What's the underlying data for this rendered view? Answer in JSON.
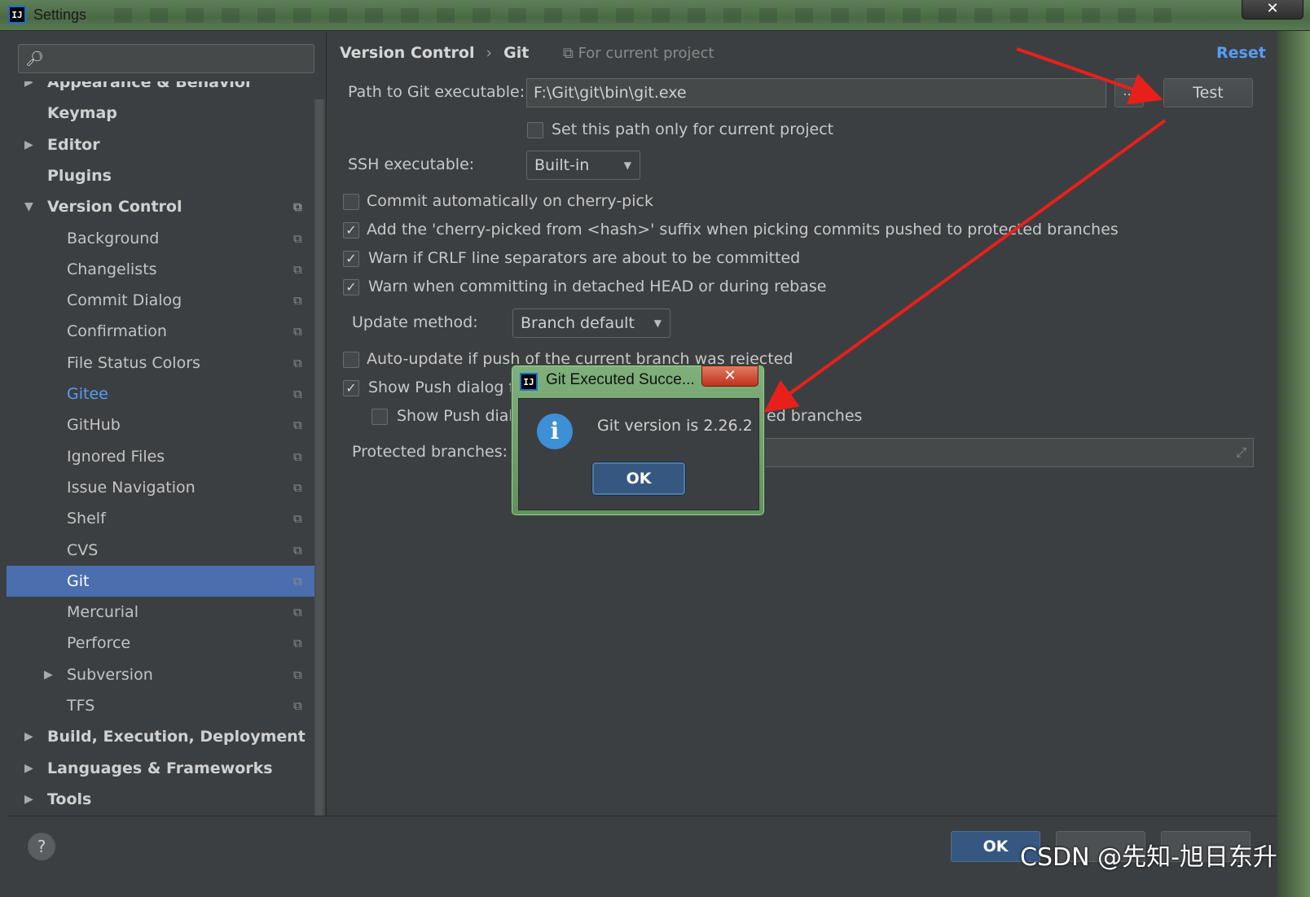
{
  "window": {
    "title": "Settings",
    "close_glyph": "✕"
  },
  "search": {
    "icon": "search-icon",
    "placeholder": ""
  },
  "tree": {
    "items": [
      {
        "label": "Appearance & Behavior",
        "level": 0,
        "bold": true,
        "expander": "right"
      },
      {
        "label": "Keymap",
        "level": 0,
        "bold": true
      },
      {
        "label": "Editor",
        "level": 0,
        "bold": true,
        "expander": "right"
      },
      {
        "label": "Plugins",
        "level": 0,
        "bold": true
      },
      {
        "label": "Version Control",
        "level": 0,
        "bold": true,
        "expander": "down",
        "project": true
      },
      {
        "label": "Background",
        "level": 1,
        "project": true
      },
      {
        "label": "Changelists",
        "level": 1,
        "project": true
      },
      {
        "label": "Commit Dialog",
        "level": 1,
        "project": true
      },
      {
        "label": "Confirmation",
        "level": 1,
        "project": true
      },
      {
        "label": "File Status Colors",
        "level": 1,
        "project": true
      },
      {
        "label": "Gitee",
        "level": 1,
        "project": true,
        "link": true
      },
      {
        "label": "GitHub",
        "level": 1,
        "project": true
      },
      {
        "label": "Ignored Files",
        "level": 1,
        "project": true
      },
      {
        "label": "Issue Navigation",
        "level": 1,
        "project": true
      },
      {
        "label": "Shelf",
        "level": 1,
        "project": true
      },
      {
        "label": "CVS",
        "level": 1,
        "project": true
      },
      {
        "label": "Git",
        "level": 1,
        "project": true,
        "selected": true
      },
      {
        "label": "Mercurial",
        "level": 1,
        "project": true
      },
      {
        "label": "Perforce",
        "level": 1,
        "project": true
      },
      {
        "label": "Subversion",
        "level": 1,
        "project": true,
        "expander": "right"
      },
      {
        "label": "TFS",
        "level": 1,
        "project": true
      },
      {
        "label": "Build, Execution, Deployment",
        "level": 0,
        "bold": true,
        "expander": "right"
      },
      {
        "label": "Languages & Frameworks",
        "level": 0,
        "bold": true,
        "expander": "right"
      },
      {
        "label": "Tools",
        "level": 0,
        "bold": true,
        "expander": "right"
      }
    ]
  },
  "header": {
    "breadcrumb_parent": "Version Control",
    "breadcrumb_sep": "›",
    "breadcrumb_current": "Git",
    "for_current_project": "For current project",
    "reset": "Reset"
  },
  "git": {
    "path_label": "Path to Git executable:",
    "path_value": "F:\\Git\\git\\bin\\git.exe",
    "browse_label": "...",
    "test_label": "Test",
    "set_path_only": "Set this path only for current project",
    "ssh_label": "SSH executable:",
    "ssh_value": "Built-in",
    "commit_auto": "Commit automatically on cherry-pick",
    "cherry_suffix": "Add the 'cherry-picked from <hash>' suffix when picking commits pushed to protected branches",
    "warn_crlf": "Warn if CRLF line separators are about to be committed",
    "warn_detached": "Warn when committing in detached HEAD or during rebase",
    "update_label": "Update method:",
    "update_value": "Branch default",
    "auto_update": "Auto-update if push of the current branch was rejected",
    "show_push_visible": "Show Push dialog fo",
    "show_push_sub_visible": "Show Push dialo",
    "show_push_sub_tail": "ed branches",
    "protected_label": "Protected branches:"
  },
  "dialog": {
    "title": "Git Executed Succe...",
    "close_glyph": "✕",
    "message": "Git version is 2.26.2",
    "ok": "OK"
  },
  "footer": {
    "help": "?",
    "ok": "OK"
  },
  "watermark": "CSDN @先知-旭日东升",
  "colors": {
    "accent": "#4b6eaf",
    "link": "#589df6",
    "annotation_arrow": "#e8201c"
  }
}
